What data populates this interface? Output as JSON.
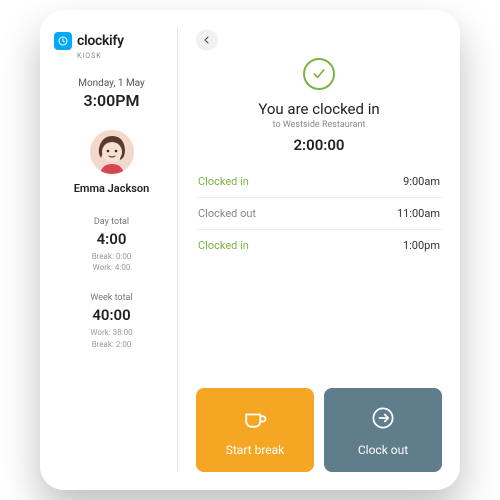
{
  "brand": {
    "name": "clockify",
    "mode": "KIOSK"
  },
  "sidebar": {
    "date": "Monday, 1 May",
    "time": "3:00PM",
    "user_name": "Emma Jackson",
    "day": {
      "label": "Day total",
      "value": "4:00",
      "break": "Break: 0:00",
      "work": "Work: 4:00"
    },
    "week": {
      "label": "Week total",
      "value": "40:00",
      "work": "Work: 38:00",
      "break": "Break: 2:00"
    }
  },
  "status": {
    "title": "You are clocked in",
    "subtitle": "to Westside Restaurant",
    "session_time": "2:00:00"
  },
  "log": [
    {
      "label": "Clocked in",
      "time": "9:00am",
      "tone": "green"
    },
    {
      "label": "Clocked out",
      "time": "11:00am",
      "tone": "grey"
    },
    {
      "label": "Clocked in",
      "time": "1:00pm",
      "tone": "green"
    }
  ],
  "actions": {
    "break": "Start break",
    "clockout": "Clock out"
  },
  "colors": {
    "accent_green": "#7cb342",
    "accent_orange": "#f5a623",
    "accent_slate": "#607d8b",
    "brand_blue": "#03a9f4"
  }
}
